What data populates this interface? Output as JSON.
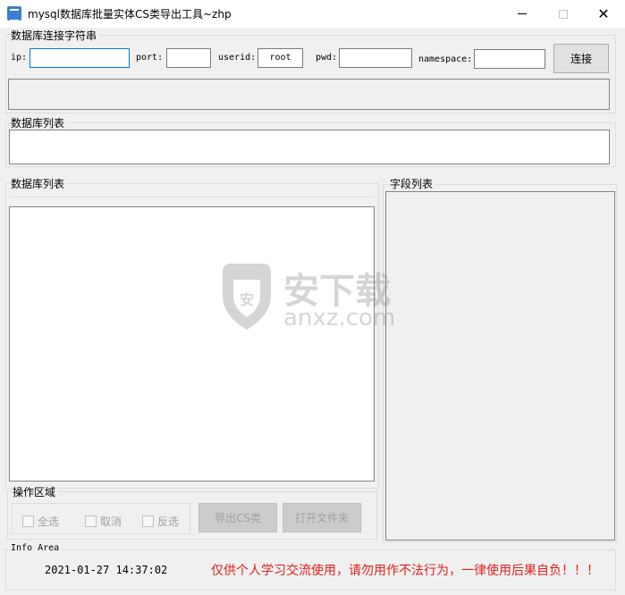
{
  "window": {
    "title": "mysql数据库批量实体CS类导出工具~zhp",
    "controls": [
      "minimize",
      "maximize",
      "close"
    ]
  },
  "connection": {
    "group_label": "数据库连接字符串",
    "ip_label": "ip:",
    "ip_value": "",
    "port_label": "port:",
    "port_value": "",
    "userid_label": "userid:",
    "userid_value": "root",
    "pwd_label": "pwd:",
    "pwd_value": "",
    "namespace_label": "namespace:",
    "namespace_value": "",
    "connect_button": "连接"
  },
  "db_list_top": {
    "label": "数据库列表"
  },
  "db_list_main": {
    "label": "数据库列表"
  },
  "field_list": {
    "label": "字段列表"
  },
  "operations": {
    "label": "操作区域",
    "select_all": "全选",
    "cancel": "取消",
    "invert": "反选",
    "export_button": "导出CS类",
    "open_folder_button": "打开文件夹"
  },
  "info": {
    "label": "Info Area",
    "datetime": "2021-01-27 14:37:02",
    "warning": "仅供个人学习交流使用，请勿用作不法行为，一律使用后果自负！！！"
  },
  "watermark": {
    "text": "安下载",
    "sub": "anxz.com"
  },
  "colors": {
    "accent": "#0078d7",
    "warning": "#e0201a"
  }
}
